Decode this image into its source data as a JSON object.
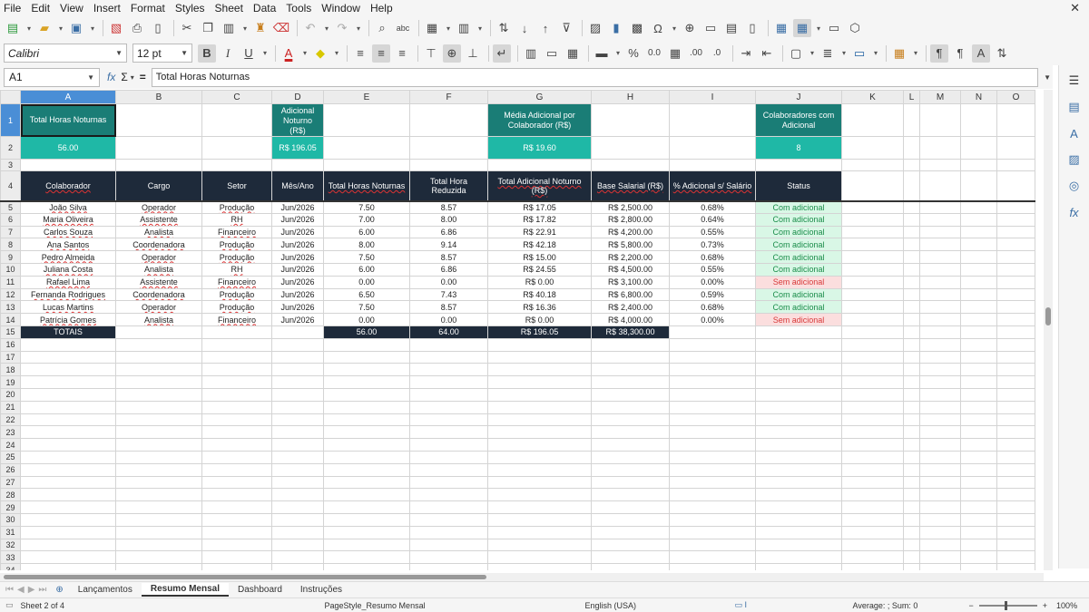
{
  "menu": [
    "File",
    "Edit",
    "View",
    "Insert",
    "Format",
    "Styles",
    "Sheet",
    "Data",
    "Tools",
    "Window",
    "Help"
  ],
  "toolbar": {
    "font_name": "Calibri",
    "font_size": "12 pt"
  },
  "formula": {
    "cell_ref": "A1",
    "fx": "fx",
    "sigma": "Σ",
    "equals": "=",
    "content": "Total Horas Noturnas"
  },
  "columns": [
    "A",
    "B",
    "C",
    "D",
    "E",
    "F",
    "G",
    "H",
    "I",
    "J",
    "K",
    "L",
    "M",
    "N",
    "O"
  ],
  "summary": {
    "a1": "Total Horas Noturnas",
    "a2": "56.00",
    "d1": "Adicional Noturno (R$)",
    "d2": "R$ 196.05",
    "g1": "Média Adicional por Colaborador (R$)",
    "g2": "R$ 19.60",
    "j1": "Colaboradores com Adicional",
    "j2": "8"
  },
  "headers": [
    "Colaborador",
    "Cargo",
    "Setor",
    "Mês/Ano",
    "Total Horas Noturnas",
    "Total Hora Reduzida",
    "Total Adicional Noturno (R$)",
    "Base Salarial (R$)",
    "% Adicional s/ Salário",
    "Status"
  ],
  "rows": [
    [
      "João Silva",
      "Operador",
      "Produção",
      "Jun/2026",
      "7.50",
      "8.57",
      "R$ 17.05",
      "R$ 2,500.00",
      "0.68%",
      "Com adicional"
    ],
    [
      "Maria Oliveira",
      "Assistente",
      "RH",
      "Jun/2026",
      "7.00",
      "8.00",
      "R$ 17.82",
      "R$ 2,800.00",
      "0.64%",
      "Com adicional"
    ],
    [
      "Carlos Souza",
      "Analista",
      "Financeiro",
      "Jun/2026",
      "6.00",
      "6.86",
      "R$ 22.91",
      "R$ 4,200.00",
      "0.55%",
      "Com adicional"
    ],
    [
      "Ana Santos",
      "Coordenadora",
      "Produção",
      "Jun/2026",
      "8.00",
      "9.14",
      "R$ 42.18",
      "R$ 5,800.00",
      "0.73%",
      "Com adicional"
    ],
    [
      "Pedro Almeida",
      "Operador",
      "Produção",
      "Jun/2026",
      "7.50",
      "8.57",
      "R$ 15.00",
      "R$ 2,200.00",
      "0.68%",
      "Com adicional"
    ],
    [
      "Juliana Costa",
      "Analista",
      "RH",
      "Jun/2026",
      "6.00",
      "6.86",
      "R$ 24.55",
      "R$ 4,500.00",
      "0.55%",
      "Com adicional"
    ],
    [
      "Rafael Lima",
      "Assistente",
      "Financeiro",
      "Jun/2026",
      "0.00",
      "0.00",
      "R$ 0.00",
      "R$ 3,100.00",
      "0.00%",
      "Sem adicional"
    ],
    [
      "Fernanda Rodrigues",
      "Coordenadora",
      "Produção",
      "Jun/2026",
      "6.50",
      "7.43",
      "R$ 40.18",
      "R$ 6,800.00",
      "0.59%",
      "Com adicional"
    ],
    [
      "Lucas Martins",
      "Operador",
      "Produção",
      "Jun/2026",
      "7.50",
      "8.57",
      "R$ 16.36",
      "R$ 2,400.00",
      "0.68%",
      "Com adicional"
    ],
    [
      "Patrícia Gomes",
      "Analista",
      "Financeiro",
      "Jun/2026",
      "0.00",
      "0.00",
      "R$ 0.00",
      "R$ 4,000.00",
      "0.00%",
      "Sem adicional"
    ]
  ],
  "totals": {
    "label": "TOTAIS",
    "hours": "56.00",
    "reduced": "64.00",
    "amount": "R$ 196.05",
    "base": "R$ 38,300.00"
  },
  "tabs": [
    "Lançamentos",
    "Resumo Mensal",
    "Dashboard",
    "Instruções"
  ],
  "active_tab": "Resumo Mensal",
  "status": {
    "sheet": "Sheet 2 of 4",
    "pagestyle": "PageStyle_Resumo Mensal",
    "language": "English (USA)",
    "sum": "Average: ; Sum: 0",
    "zoom": "100%"
  },
  "colors": {
    "teal_dark": "#1a7d76",
    "teal_light": "#1fb8a6",
    "navy": "#1e2a3a",
    "ok_bg": "#d9f7e6",
    "ok_fg": "#1a8d4a",
    "no_bg": "#fbdede",
    "no_fg": "#d83a3a"
  }
}
